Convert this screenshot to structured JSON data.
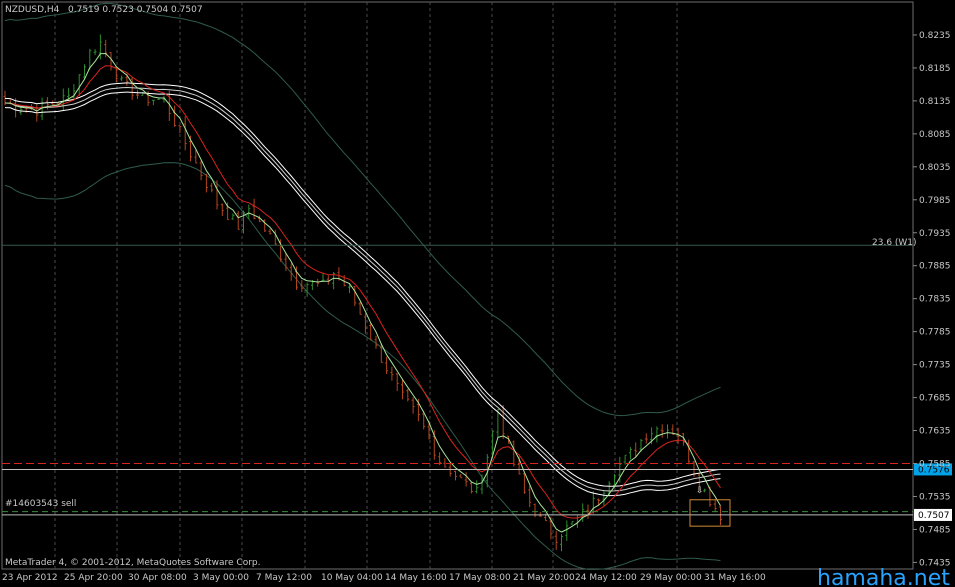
{
  "header": {
    "symbol": "NZDUSD,H4",
    "ohlc": "0.7519 0.7523 0.7504 0.7507"
  },
  "footer": {
    "copyright": "MetaTrader 4, © 2001-2012, MetaQuotes Software Corp."
  },
  "watermark": "hamaha.net",
  "order_label": "#14603543 sell",
  "fib_label": "23.6 (W1)",
  "colors": {
    "background": "#000000",
    "up_candle": "#2e8b2e",
    "down_candle": "#b2461e",
    "price_text": "#c8c8c8",
    "ask_badge": "#00a2e8",
    "bid_badge": "#ffffff",
    "red_line": "#d9231f",
    "green_line": "#a9e49a",
    "envelope": "#2f5c4a",
    "watermark": "#2aa3ff"
  },
  "chart_data": {
    "type": "candlestick",
    "price_axis": [
      "0.8235",
      "0.8185",
      "0.8135",
      "0.8085",
      "0.8035",
      "0.7985",
      "0.7935",
      "0.7885",
      "0.7835",
      "0.7785",
      "0.7735",
      "0.7685",
      "0.7635",
      "0.7585",
      "0.7535",
      "0.7485",
      "0.7435"
    ],
    "time_axis": [
      "23 Apr 2012",
      "25 Apr 20:00",
      "30 Apr 08:00",
      "3 May 00:00",
      "7 May 12:00",
      "10 May 04:00",
      "14 May 16:00",
      "17 May 08:00",
      "21 May 20:00",
      "24 May 12:00",
      "29 May 00:00",
      "31 May 16:00"
    ],
    "ylim": [
      0.7425,
      0.8285
    ],
    "current_ask": "0.7576",
    "current_bid": "0.7507",
    "red_ma_level": 0.7585,
    "sell_order_level": 0.7512,
    "fib_level": 0.7916,
    "path_points": [
      [
        0,
        0.8132
      ],
      [
        6,
        0.8121
      ],
      [
        12,
        0.8141
      ],
      [
        16,
        0.8208
      ],
      [
        18,
        0.8223
      ],
      [
        22,
        0.8162
      ],
      [
        26,
        0.8139
      ],
      [
        30,
        0.8136
      ],
      [
        35,
        0.8055
      ],
      [
        40,
        0.798
      ],
      [
        44,
        0.7945
      ],
      [
        46,
        0.7972
      ],
      [
        50,
        0.7929
      ],
      [
        55,
        0.786
      ],
      [
        60,
        0.7855
      ],
      [
        62,
        0.7874
      ],
      [
        65,
        0.7847
      ],
      [
        70,
        0.776
      ],
      [
        75,
        0.7685
      ],
      [
        78,
        0.7655
      ],
      [
        82,
        0.759
      ],
      [
        86,
        0.756
      ],
      [
        89,
        0.754
      ],
      [
        91,
        0.7597
      ],
      [
        93,
        0.7668
      ],
      [
        95,
        0.7607
      ],
      [
        98,
        0.754
      ],
      [
        101,
        0.75
      ],
      [
        104,
        0.7474
      ],
      [
        108,
        0.75
      ],
      [
        112,
        0.7535
      ],
      [
        115,
        0.7575
      ],
      [
        118,
        0.76
      ],
      [
        121,
        0.763
      ],
      [
        124,
        0.7642
      ],
      [
        127,
        0.763
      ],
      [
        129,
        0.7595
      ],
      [
        131,
        0.7555
      ],
      [
        133,
        0.753
      ],
      [
        135,
        0.7507
      ]
    ]
  }
}
